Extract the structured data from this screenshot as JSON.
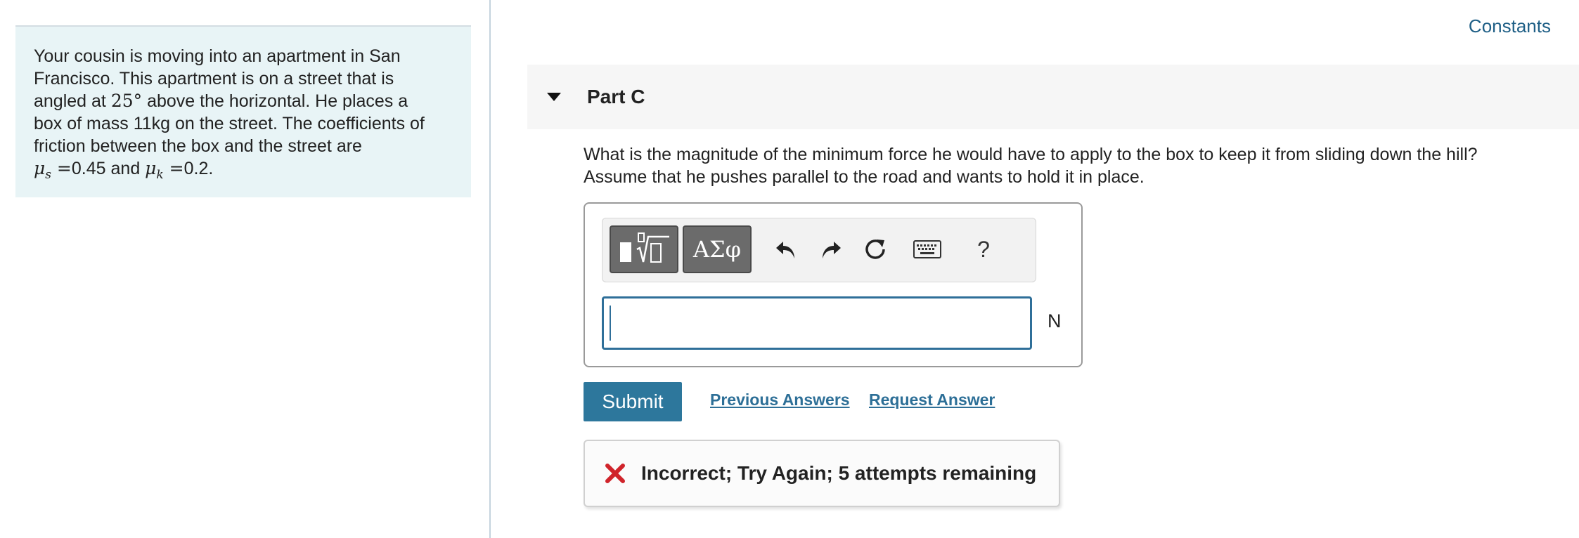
{
  "problem": {
    "line1": "Your cousin is moving into an apartment in San",
    "line2": "Francisco.  This apartment is on a street that is",
    "line3_pre": "angled at ",
    "angle": "25",
    "degree": "°",
    "line3_post": " above the horizontal.  He places a",
    "line4": "box of mass 11kg on the street.  The coefficients of",
    "line5": "friction between the box and the street are",
    "mu_symbol": "μ",
    "mu_s_sub": "s",
    "mu_s_eq": " =",
    "mu_s_value": "0.45",
    "and_text": " and ",
    "mu_k_sub": "k",
    "mu_k_eq": " =",
    "mu_k_value": "0.2."
  },
  "header": {
    "constants_label": "Constants"
  },
  "part": {
    "title": "Part C",
    "question_line1": "What is the magnitude of the minimum force he would have to apply to the box to keep it from sliding down the hill?",
    "question_line2": "Assume that he pushes parallel to the road and wants to hold it in place."
  },
  "toolbar": {
    "templates_icon": "templates-icon",
    "greek_label": "ΑΣφ",
    "undo_icon": "undo-icon",
    "redo_icon": "redo-icon",
    "reset_icon": "reset-icon",
    "keyboard_icon": "keyboard-icon",
    "help_label": "?"
  },
  "answer": {
    "value": "",
    "unit": "N"
  },
  "actions": {
    "submit_label": "Submit",
    "previous_answers": "Previous Answers",
    "request_answer": "Request Answer"
  },
  "feedback": {
    "icon": "x-icon",
    "text": "Incorrect; Try Again; 5 attempts remaining",
    "icon_color": "#d0242b"
  },
  "colors": {
    "accent": "#2d779c",
    "link": "#2d6f97",
    "panel_bg": "#e8f4f6",
    "input_border": "#2f6f99"
  }
}
